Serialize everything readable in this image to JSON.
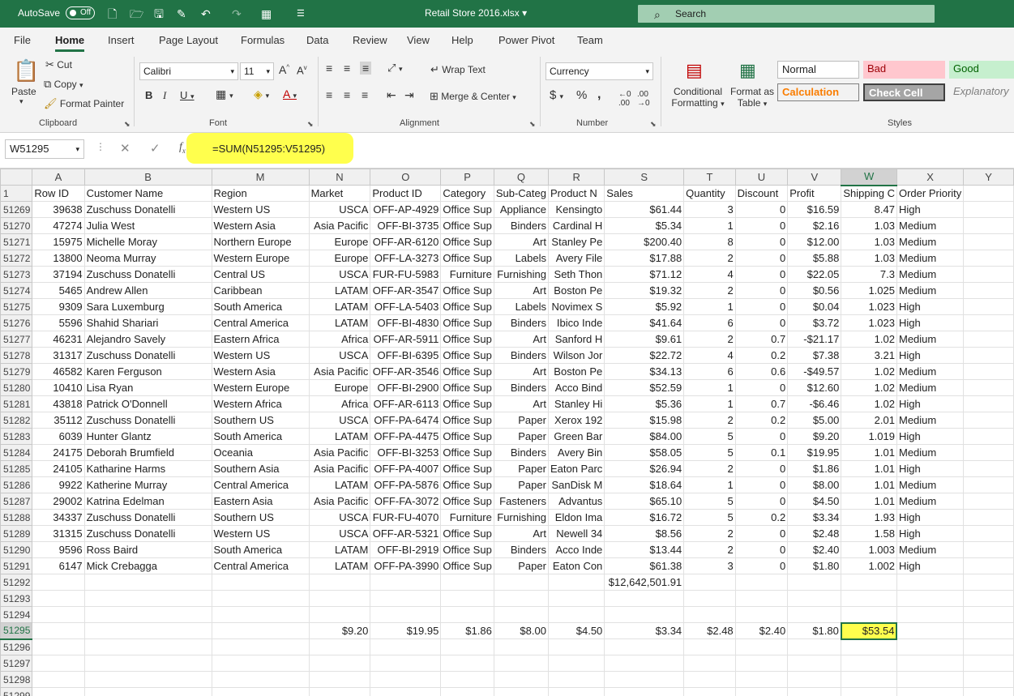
{
  "titlebar": {
    "autosave_label": "AutoSave",
    "autosave_state": "Off",
    "filename": "Retail Store 2016.xlsx",
    "search_placeholder": "Search"
  },
  "menu": {
    "tabs": [
      "File",
      "Home",
      "Insert",
      "Page Layout",
      "Formulas",
      "Data",
      "Review",
      "View",
      "Help",
      "Power Pivot",
      "Team"
    ],
    "active": "Home"
  },
  "ribbon": {
    "clipboard": {
      "paste": "Paste",
      "cut": "Cut",
      "copy": "Copy",
      "format_painter": "Format Painter",
      "label": "Clipboard"
    },
    "font": {
      "name": "Calibri",
      "size": "11",
      "label": "Font"
    },
    "alignment": {
      "wrap": "Wrap Text",
      "merge": "Merge & Center",
      "label": "Alignment"
    },
    "number": {
      "format": "Currency",
      "label": "Number"
    },
    "styles": {
      "conditional": "Conditional Formatting",
      "format_table": "Format as Table",
      "normal": "Normal",
      "bad": "Bad",
      "good": "Good",
      "calculation": "Calculation",
      "check": "Check Cell",
      "explanatory": "Explanatory",
      "label": "Styles"
    }
  },
  "formula_bar": {
    "name_box": "W51295",
    "formula": "=SUM(N51295:V51295)"
  },
  "grid": {
    "columns": [
      "A",
      "B",
      "M",
      "N",
      "O",
      "P",
      "Q",
      "R",
      "S",
      "T",
      "U",
      "V",
      "W",
      "X",
      "Y"
    ],
    "selected_column": "W",
    "header_row_number": "1",
    "headers": [
      "Row ID",
      "Customer Name",
      "Region",
      "Market",
      "Product ID",
      "Category",
      "Sub-Categ",
      "Product N",
      "Sales",
      "Quantity",
      "Discount",
      "Profit",
      "Shipping C",
      "Order Priority",
      ""
    ],
    "rows": [
      {
        "n": "51269",
        "c": [
          "39638",
          "Zuschuss Donatelli",
          "Western US",
          "USCA",
          "OFF-AP-4929",
          "Office Sup",
          "Appliance",
          "Kensingto",
          "$61.44",
          "3",
          "0",
          "$16.59",
          "8.47",
          "High",
          ""
        ]
      },
      {
        "n": "51270",
        "c": [
          "47274",
          "Julia West",
          "Western Asia",
          "Asia Pacific",
          "OFF-BI-3735",
          "Office Sup",
          "Binders",
          "Cardinal H",
          "$5.34",
          "1",
          "0",
          "$2.16",
          "1.03",
          "Medium",
          ""
        ]
      },
      {
        "n": "51271",
        "c": [
          "15975",
          "Michelle Moray",
          "Northern Europe",
          "Europe",
          "OFF-AR-6120",
          "Office Sup",
          "Art",
          "Stanley Pe",
          "$200.40",
          "8",
          "0",
          "$12.00",
          "1.03",
          "Medium",
          ""
        ]
      },
      {
        "n": "51272",
        "c": [
          "13800",
          "Neoma Murray",
          "Western Europe",
          "Europe",
          "OFF-LA-3273",
          "Office Sup",
          "Labels",
          "Avery File",
          "$17.88",
          "2",
          "0",
          "$5.88",
          "1.03",
          "Medium",
          ""
        ]
      },
      {
        "n": "51273",
        "c": [
          "37194",
          "Zuschuss Donatelli",
          "Central US",
          "USCA",
          "FUR-FU-5983",
          "Furniture",
          "Furnishing",
          "Seth Thon",
          "$71.12",
          "4",
          "0",
          "$22.05",
          "7.3",
          "Medium",
          ""
        ]
      },
      {
        "n": "51274",
        "c": [
          "5465",
          "Andrew Allen",
          "Caribbean",
          "LATAM",
          "OFF-AR-3547",
          "Office Sup",
          "Art",
          "Boston Pe",
          "$19.32",
          "2",
          "0",
          "$0.56",
          "1.025",
          "Medium",
          ""
        ]
      },
      {
        "n": "51275",
        "c": [
          "9309",
          "Sara Luxemburg",
          "South America",
          "LATAM",
          "OFF-LA-5403",
          "Office Sup",
          "Labels",
          "Novimex S",
          "$5.92",
          "1",
          "0",
          "$0.04",
          "1.023",
          "High",
          ""
        ]
      },
      {
        "n": "51276",
        "c": [
          "5596",
          "Shahid Shariari",
          "Central America",
          "LATAM",
          "OFF-BI-4830",
          "Office Sup",
          "Binders",
          "Ibico Inde",
          "$41.64",
          "6",
          "0",
          "$3.72",
          "1.023",
          "High",
          ""
        ]
      },
      {
        "n": "51277",
        "c": [
          "46231",
          "Alejandro Savely",
          "Eastern Africa",
          "Africa",
          "OFF-AR-5911",
          "Office Sup",
          "Art",
          "Sanford H",
          "$9.61",
          "2",
          "0.7",
          "-$21.17",
          "1.02",
          "Medium",
          ""
        ]
      },
      {
        "n": "51278",
        "c": [
          "31317",
          "Zuschuss Donatelli",
          "Western US",
          "USCA",
          "OFF-BI-6395",
          "Office Sup",
          "Binders",
          "Wilson Jor",
          "$22.72",
          "4",
          "0.2",
          "$7.38",
          "3.21",
          "High",
          ""
        ]
      },
      {
        "n": "51279",
        "c": [
          "46582",
          "Karen Ferguson",
          "Western Asia",
          "Asia Pacific",
          "OFF-AR-3546",
          "Office Sup",
          "Art",
          "Boston Pe",
          "$34.13",
          "6",
          "0.6",
          "-$49.57",
          "1.02",
          "Medium",
          ""
        ]
      },
      {
        "n": "51280",
        "c": [
          "10410",
          "Lisa Ryan",
          "Western Europe",
          "Europe",
          "OFF-BI-2900",
          "Office Sup",
          "Binders",
          "Acco Bind",
          "$52.59",
          "1",
          "0",
          "$12.60",
          "1.02",
          "Medium",
          ""
        ]
      },
      {
        "n": "51281",
        "c": [
          "43818",
          "Patrick O'Donnell",
          "Western Africa",
          "Africa",
          "OFF-AR-6113",
          "Office Sup",
          "Art",
          "Stanley Hi",
          "$5.36",
          "1",
          "0.7",
          "-$6.46",
          "1.02",
          "High",
          ""
        ]
      },
      {
        "n": "51282",
        "c": [
          "35112",
          "Zuschuss Donatelli",
          "Southern US",
          "USCA",
          "OFF-PA-6474",
          "Office Sup",
          "Paper",
          "Xerox 192",
          "$15.98",
          "2",
          "0.2",
          "$5.00",
          "2.01",
          "Medium",
          ""
        ]
      },
      {
        "n": "51283",
        "c": [
          "6039",
          "Hunter Glantz",
          "South America",
          "LATAM",
          "OFF-PA-4475",
          "Office Sup",
          "Paper",
          "Green Bar",
          "$84.00",
          "5",
          "0",
          "$9.20",
          "1.019",
          "High",
          ""
        ]
      },
      {
        "n": "51284",
        "c": [
          "24175",
          "Deborah Brumfield",
          "Oceania",
          "Asia Pacific",
          "OFF-BI-3253",
          "Office Sup",
          "Binders",
          "Avery Bin",
          "$58.05",
          "5",
          "0.1",
          "$19.95",
          "1.01",
          "Medium",
          ""
        ]
      },
      {
        "n": "51285",
        "c": [
          "24105",
          "Katharine Harms",
          "Southern Asia",
          "Asia Pacific",
          "OFF-PA-4007",
          "Office Sup",
          "Paper",
          "Eaton Parc",
          "$26.94",
          "2",
          "0",
          "$1.86",
          "1.01",
          "High",
          ""
        ]
      },
      {
        "n": "51286",
        "c": [
          "9922",
          "Katherine Murray",
          "Central America",
          "LATAM",
          "OFF-PA-5876",
          "Office Sup",
          "Paper",
          "SanDisk M",
          "$18.64",
          "1",
          "0",
          "$8.00",
          "1.01",
          "Medium",
          ""
        ]
      },
      {
        "n": "51287",
        "c": [
          "29002",
          "Katrina Edelman",
          "Eastern Asia",
          "Asia Pacific",
          "OFF-FA-3072",
          "Office Sup",
          "Fasteners",
          "Advantus",
          "$65.10",
          "5",
          "0",
          "$4.50",
          "1.01",
          "Medium",
          ""
        ]
      },
      {
        "n": "51288",
        "c": [
          "34337",
          "Zuschuss Donatelli",
          "Southern US",
          "USCA",
          "FUR-FU-4070",
          "Furniture",
          "Furnishing",
          "Eldon Ima",
          "$16.72",
          "5",
          "0.2",
          "$3.34",
          "1.93",
          "High",
          ""
        ]
      },
      {
        "n": "51289",
        "c": [
          "31315",
          "Zuschuss Donatelli",
          "Western US",
          "USCA",
          "OFF-AR-5321",
          "Office Sup",
          "Art",
          "Newell 34",
          "$8.56",
          "2",
          "0",
          "$2.48",
          "1.58",
          "High",
          ""
        ]
      },
      {
        "n": "51290",
        "c": [
          "9596",
          "Ross Baird",
          "South America",
          "LATAM",
          "OFF-BI-2919",
          "Office Sup",
          "Binders",
          "Acco Inde",
          "$13.44",
          "2",
          "0",
          "$2.40",
          "1.003",
          "Medium",
          ""
        ]
      },
      {
        "n": "51291",
        "c": [
          "6147",
          "Mick Crebagga",
          "Central America",
          "LATAM",
          "OFF-PA-3990",
          "Office Sup",
          "Paper",
          "Eaton Con",
          "$61.38",
          "3",
          "0",
          "$1.80",
          "1.002",
          "High",
          ""
        ]
      },
      {
        "n": "51292",
        "c": [
          "",
          "",
          "",
          "",
          "",
          "",
          "",
          "",
          "$12,642,501.91",
          "",
          "",
          "",
          "",
          "",
          ""
        ]
      },
      {
        "n": "51293",
        "c": [
          "",
          "",
          "",
          "",
          "",
          "",
          "",
          "",
          "",
          "",
          "",
          "",
          "",
          "",
          ""
        ]
      },
      {
        "n": "51294",
        "c": [
          "",
          "",
          "",
          "",
          "",
          "",
          "",
          "",
          "",
          "",
          "",
          "",
          "",
          "",
          ""
        ]
      },
      {
        "n": "51295",
        "c": [
          "",
          "",
          "",
          "$9.20",
          "$19.95",
          "$1.86",
          "$8.00",
          "$4.50",
          "$3.34",
          "$2.48",
          "$2.40",
          "$1.80",
          "$53.54",
          "",
          ""
        ]
      },
      {
        "n": "51296",
        "c": [
          "",
          "",
          "",
          "",
          "",
          "",
          "",
          "",
          "",
          "",
          "",
          "",
          "",
          "",
          ""
        ]
      },
      {
        "n": "51297",
        "c": [
          "",
          "",
          "",
          "",
          "",
          "",
          "",
          "",
          "",
          "",
          "",
          "",
          "",
          "",
          ""
        ]
      },
      {
        "n": "51298",
        "c": [
          "",
          "",
          "",
          "",
          "",
          "",
          "",
          "",
          "",
          "",
          "",
          "",
          "",
          "",
          ""
        ]
      },
      {
        "n": "51299",
        "c": [
          "",
          "",
          "",
          "",
          "",
          "",
          "",
          "",
          "",
          "",
          "",
          "",
          "",
          "",
          ""
        ]
      }
    ],
    "selected_row": "51295"
  },
  "colors": {
    "brand": "#217346",
    "highlight": "#ffff4d"
  }
}
